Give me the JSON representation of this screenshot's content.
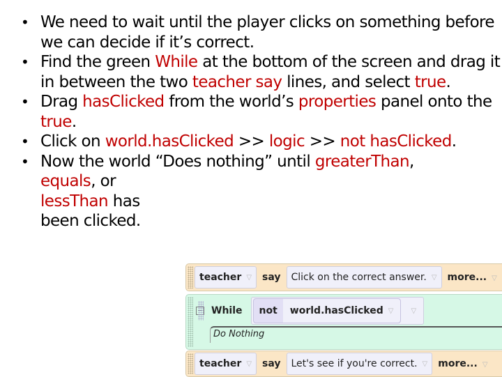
{
  "bullets": [
    {
      "segments": [
        {
          "text": "We need to wait until the player clicks on something before we can decide if it’s correct.",
          "hl": false
        }
      ]
    },
    {
      "segments": [
        {
          "text": "Find the green ",
          "hl": false
        },
        {
          "text": "While",
          "hl": true
        },
        {
          "text": " at the bottom of the screen and drag it in between the two ",
          "hl": false
        },
        {
          "text": "teacher say",
          "hl": true
        },
        {
          "text": " lines, and select ",
          "hl": false
        },
        {
          "text": "true",
          "hl": true
        },
        {
          "text": ".",
          "hl": false
        }
      ]
    },
    {
      "segments": [
        {
          "text": "Drag ",
          "hl": false
        },
        {
          "text": "hasClicked",
          "hl": true
        },
        {
          "text": " from the world’s ",
          "hl": false
        },
        {
          "text": "properties",
          "hl": true
        },
        {
          "text": " panel onto the ",
          "hl": false
        },
        {
          "text": "true",
          "hl": true
        },
        {
          "text": ".",
          "hl": false
        }
      ]
    },
    {
      "segments": [
        {
          "text": "Click on ",
          "hl": false
        },
        {
          "text": "world.hasClicked",
          "hl": true
        },
        {
          "text": " >> ",
          "hl": false
        },
        {
          "text": "logic",
          "hl": true
        },
        {
          "text": " >> ",
          "hl": false
        },
        {
          "text": "not hasClicked",
          "hl": true
        },
        {
          "text": ".",
          "hl": false
        }
      ]
    },
    {
      "line1": [
        {
          "text": "Now the world “Does nothing” until ",
          "hl": false
        },
        {
          "text": "greaterThan",
          "hl": true
        },
        {
          "text": ",",
          "hl": false
        }
      ],
      "line2": [
        {
          "text": "equals",
          "hl": true
        },
        {
          "text": ", or",
          "hl": false
        }
      ],
      "line3": [
        {
          "text": "lessThan",
          "hl": true
        },
        {
          "text": " has",
          "hl": false
        }
      ],
      "line4": [
        {
          "text": "been clicked.",
          "hl": false
        }
      ]
    }
  ],
  "colors": {
    "highlight": "#c00000"
  },
  "code": {
    "row1": {
      "object": "teacher",
      "method": "say",
      "arg": "Click on the correct answer.",
      "more": "more..."
    },
    "while": {
      "keyword": "While",
      "not": "not",
      "condition": "world.hasClicked",
      "body": "Do Nothing"
    },
    "row3": {
      "object": "teacher",
      "method": "say",
      "arg": "Let's see if you're correct.",
      "more": "more..."
    }
  }
}
